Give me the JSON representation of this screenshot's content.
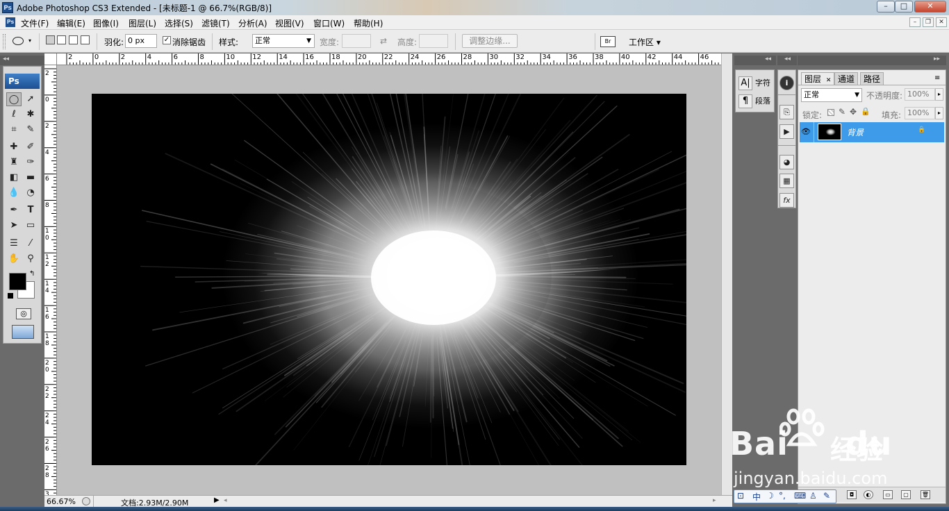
{
  "window": {
    "title": "Adobe Photoshop CS3 Extended - [未标题-1 @ 66.7%(RGB/8)]",
    "app_icon": "Ps",
    "buttons": {
      "minimize": "–",
      "maximize": "□",
      "close": "✕"
    }
  },
  "menubar": {
    "items": [
      "文件(F)",
      "编辑(E)",
      "图像(I)",
      "图层(L)",
      "选择(S)",
      "滤镜(T)",
      "分析(A)",
      "视图(V)",
      "窗口(W)",
      "帮助(H)"
    ],
    "doc_buttons": {
      "minimize": "–",
      "restore": "❐",
      "close": "✕"
    }
  },
  "options": {
    "feather_label": "羽化:",
    "feather_value": "0 px",
    "antialias_label": "消除锯齿",
    "antialias_checked": "✓",
    "style_label": "样式:",
    "style_value": "正常",
    "width_label": "宽度:",
    "height_label": "高度:",
    "swap_icon": "⇄",
    "refine_edge": "调整边缘...",
    "workspace_label": "工作区 ▾"
  },
  "toolbox": {
    "logo": "Ps"
  },
  "ruler_h": [
    "2",
    "0",
    "2",
    "4",
    "6",
    "8",
    "10",
    "12",
    "14",
    "16",
    "18",
    "20",
    "22",
    "24",
    "26",
    "28",
    "30",
    "32",
    "34",
    "36",
    "38",
    "40",
    "42",
    "44",
    "46"
  ],
  "ruler_v": [
    "2",
    "0",
    "2",
    "4",
    "6",
    "8",
    "1\n0",
    "1\n2",
    "1\n4",
    "1\n6",
    "1\n8",
    "2\n0",
    "2\n2",
    "2\n4",
    "2\n6",
    "2\n8",
    "3"
  ],
  "status": {
    "zoom": "66.67%",
    "doc_info": "文档:2.93M/2.90M"
  },
  "char_panel": {
    "char_label": "字符",
    "para_label": "段落",
    "char_icon": "A|",
    "para_icon": "¶"
  },
  "layers": {
    "tabs": [
      "图层",
      "通道",
      "路径"
    ],
    "tab_close": "✕",
    "blend_mode": "正常",
    "opacity_label": "不透明度:",
    "opacity_value": "100%",
    "lock_label": "锁定:",
    "fill_label": "填充:",
    "fill_value": "100%",
    "layer_name": "背景"
  },
  "watermark": {
    "brand": "Bai",
    "brand_tail": "du",
    "cn": "经验",
    "url": "jingyan.baidu.com"
  },
  "ime": {
    "mode": "中"
  },
  "colors": {
    "accent_blue": "#3d9be9",
    "canvas_bg": "#000000",
    "workspace_bg": "#c0c0c0"
  }
}
